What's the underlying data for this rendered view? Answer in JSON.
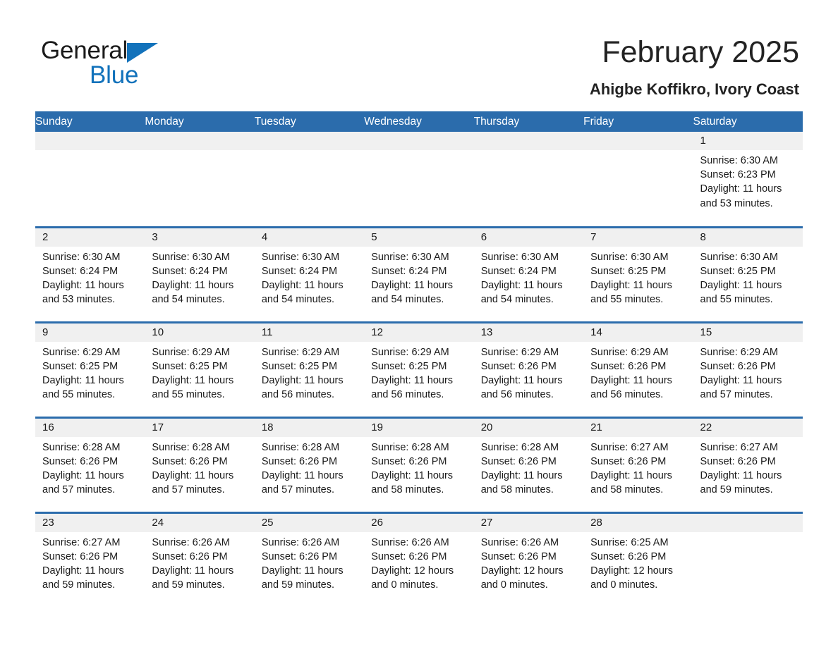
{
  "brand": {
    "word_general": "General",
    "word_blue": "Blue",
    "triangle_color": "#1272bb",
    "general_color": "#1a1a1a"
  },
  "header": {
    "month_title": "February 2025",
    "location": "Ahigbe Koffikro, Ivory Coast"
  },
  "theme": {
    "header_blue": "#2b6cac",
    "date_band_gray": "#f0f0f0",
    "text_color": "#1a1a1a",
    "page_background": "#ffffff"
  },
  "weekdays": [
    "Sunday",
    "Monday",
    "Tuesday",
    "Wednesday",
    "Thursday",
    "Friday",
    "Saturday"
  ],
  "weeks": [
    [
      {
        "date": "",
        "sunrise": "",
        "sunset": "",
        "daylight": ""
      },
      {
        "date": "",
        "sunrise": "",
        "sunset": "",
        "daylight": ""
      },
      {
        "date": "",
        "sunrise": "",
        "sunset": "",
        "daylight": ""
      },
      {
        "date": "",
        "sunrise": "",
        "sunset": "",
        "daylight": ""
      },
      {
        "date": "",
        "sunrise": "",
        "sunset": "",
        "daylight": ""
      },
      {
        "date": "",
        "sunrise": "",
        "sunset": "",
        "daylight": ""
      },
      {
        "date": "1",
        "sunrise": "Sunrise: 6:30 AM",
        "sunset": "Sunset: 6:23 PM",
        "daylight": "Daylight: 11 hours and 53 minutes."
      }
    ],
    [
      {
        "date": "2",
        "sunrise": "Sunrise: 6:30 AM",
        "sunset": "Sunset: 6:24 PM",
        "daylight": "Daylight: 11 hours and 53 minutes."
      },
      {
        "date": "3",
        "sunrise": "Sunrise: 6:30 AM",
        "sunset": "Sunset: 6:24 PM",
        "daylight": "Daylight: 11 hours and 54 minutes."
      },
      {
        "date": "4",
        "sunrise": "Sunrise: 6:30 AM",
        "sunset": "Sunset: 6:24 PM",
        "daylight": "Daylight: 11 hours and 54 minutes."
      },
      {
        "date": "5",
        "sunrise": "Sunrise: 6:30 AM",
        "sunset": "Sunset: 6:24 PM",
        "daylight": "Daylight: 11 hours and 54 minutes."
      },
      {
        "date": "6",
        "sunrise": "Sunrise: 6:30 AM",
        "sunset": "Sunset: 6:24 PM",
        "daylight": "Daylight: 11 hours and 54 minutes."
      },
      {
        "date": "7",
        "sunrise": "Sunrise: 6:30 AM",
        "sunset": "Sunset: 6:25 PM",
        "daylight": "Daylight: 11 hours and 55 minutes."
      },
      {
        "date": "8",
        "sunrise": "Sunrise: 6:30 AM",
        "sunset": "Sunset: 6:25 PM",
        "daylight": "Daylight: 11 hours and 55 minutes."
      }
    ],
    [
      {
        "date": "9",
        "sunrise": "Sunrise: 6:29 AM",
        "sunset": "Sunset: 6:25 PM",
        "daylight": "Daylight: 11 hours and 55 minutes."
      },
      {
        "date": "10",
        "sunrise": "Sunrise: 6:29 AM",
        "sunset": "Sunset: 6:25 PM",
        "daylight": "Daylight: 11 hours and 55 minutes."
      },
      {
        "date": "11",
        "sunrise": "Sunrise: 6:29 AM",
        "sunset": "Sunset: 6:25 PM",
        "daylight": "Daylight: 11 hours and 56 minutes."
      },
      {
        "date": "12",
        "sunrise": "Sunrise: 6:29 AM",
        "sunset": "Sunset: 6:25 PM",
        "daylight": "Daylight: 11 hours and 56 minutes."
      },
      {
        "date": "13",
        "sunrise": "Sunrise: 6:29 AM",
        "sunset": "Sunset: 6:26 PM",
        "daylight": "Daylight: 11 hours and 56 minutes."
      },
      {
        "date": "14",
        "sunrise": "Sunrise: 6:29 AM",
        "sunset": "Sunset: 6:26 PM",
        "daylight": "Daylight: 11 hours and 56 minutes."
      },
      {
        "date": "15",
        "sunrise": "Sunrise: 6:29 AM",
        "sunset": "Sunset: 6:26 PM",
        "daylight": "Daylight: 11 hours and 57 minutes."
      }
    ],
    [
      {
        "date": "16",
        "sunrise": "Sunrise: 6:28 AM",
        "sunset": "Sunset: 6:26 PM",
        "daylight": "Daylight: 11 hours and 57 minutes."
      },
      {
        "date": "17",
        "sunrise": "Sunrise: 6:28 AM",
        "sunset": "Sunset: 6:26 PM",
        "daylight": "Daylight: 11 hours and 57 minutes."
      },
      {
        "date": "18",
        "sunrise": "Sunrise: 6:28 AM",
        "sunset": "Sunset: 6:26 PM",
        "daylight": "Daylight: 11 hours and 57 minutes."
      },
      {
        "date": "19",
        "sunrise": "Sunrise: 6:28 AM",
        "sunset": "Sunset: 6:26 PM",
        "daylight": "Daylight: 11 hours and 58 minutes."
      },
      {
        "date": "20",
        "sunrise": "Sunrise: 6:28 AM",
        "sunset": "Sunset: 6:26 PM",
        "daylight": "Daylight: 11 hours and 58 minutes."
      },
      {
        "date": "21",
        "sunrise": "Sunrise: 6:27 AM",
        "sunset": "Sunset: 6:26 PM",
        "daylight": "Daylight: 11 hours and 58 minutes."
      },
      {
        "date": "22",
        "sunrise": "Sunrise: 6:27 AM",
        "sunset": "Sunset: 6:26 PM",
        "daylight": "Daylight: 11 hours and 59 minutes."
      }
    ],
    [
      {
        "date": "23",
        "sunrise": "Sunrise: 6:27 AM",
        "sunset": "Sunset: 6:26 PM",
        "daylight": "Daylight: 11 hours and 59 minutes."
      },
      {
        "date": "24",
        "sunrise": "Sunrise: 6:26 AM",
        "sunset": "Sunset: 6:26 PM",
        "daylight": "Daylight: 11 hours and 59 minutes."
      },
      {
        "date": "25",
        "sunrise": "Sunrise: 6:26 AM",
        "sunset": "Sunset: 6:26 PM",
        "daylight": "Daylight: 11 hours and 59 minutes."
      },
      {
        "date": "26",
        "sunrise": "Sunrise: 6:26 AM",
        "sunset": "Sunset: 6:26 PM",
        "daylight": "Daylight: 12 hours and 0 minutes."
      },
      {
        "date": "27",
        "sunrise": "Sunrise: 6:26 AM",
        "sunset": "Sunset: 6:26 PM",
        "daylight": "Daylight: 12 hours and 0 minutes."
      },
      {
        "date": "28",
        "sunrise": "Sunrise: 6:25 AM",
        "sunset": "Sunset: 6:26 PM",
        "daylight": "Daylight: 12 hours and 0 minutes."
      },
      {
        "date": "",
        "sunrise": "",
        "sunset": "",
        "daylight": ""
      }
    ]
  ]
}
